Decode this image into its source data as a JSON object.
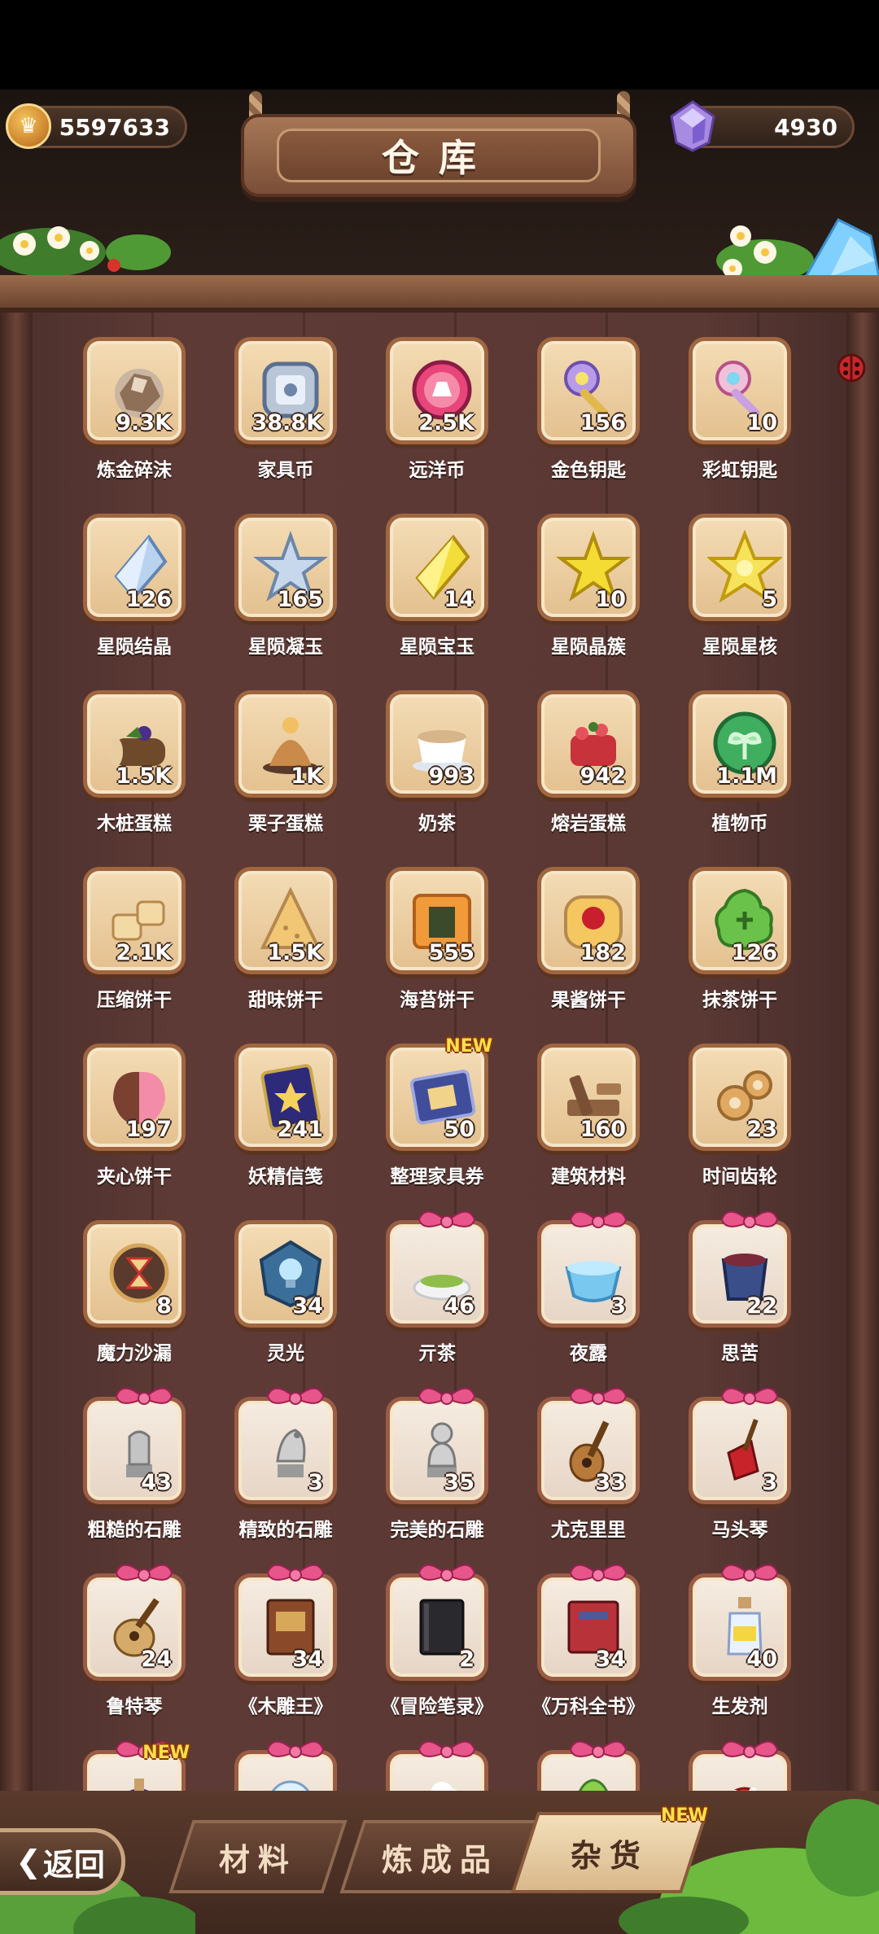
{
  "header": {
    "title": "仓库",
    "coins": "5597633",
    "gems": "4930"
  },
  "items": [
    {
      "name": "炼金碎沫",
      "count": "9.3K",
      "icon": "rock-rubble-icon",
      "type": "plain"
    },
    {
      "name": "家具币",
      "count": "38.8K",
      "icon": "furniture-coin-icon",
      "type": "plain"
    },
    {
      "name": "远洋币",
      "count": "2.5K",
      "icon": "ocean-coin-icon",
      "type": "plain"
    },
    {
      "name": "金色钥匙",
      "count": "156",
      "icon": "gold-key-icon",
      "type": "plain"
    },
    {
      "name": "彩虹钥匙",
      "count": "10",
      "icon": "rainbow-key-icon",
      "type": "plain"
    },
    {
      "name": "星陨结晶",
      "count": "126",
      "icon": "crystal-shard-icon",
      "type": "plain"
    },
    {
      "name": "星陨凝玉",
      "count": "165",
      "icon": "star-jade-icon",
      "type": "plain"
    },
    {
      "name": "星陨宝玉",
      "count": "14",
      "icon": "yellow-gem-icon",
      "type": "plain"
    },
    {
      "name": "星陨晶簇",
      "count": "10",
      "icon": "yellow-star-icon",
      "type": "plain"
    },
    {
      "name": "星陨星核",
      "count": "5",
      "icon": "star-core-icon",
      "type": "plain"
    },
    {
      "name": "木桩蛋糕",
      "count": "1.5K",
      "icon": "log-cake-icon",
      "type": "plain"
    },
    {
      "name": "栗子蛋糕",
      "count": "1K",
      "icon": "chestnut-cake-icon",
      "type": "plain"
    },
    {
      "name": "奶茶",
      "count": "993",
      "icon": "milk-tea-icon",
      "type": "plain"
    },
    {
      "name": "熔岩蛋糕",
      "count": "942",
      "icon": "lava-cake-icon",
      "type": "plain"
    },
    {
      "name": "植物币",
      "count": "1.1M",
      "icon": "plant-coin-icon",
      "type": "plain"
    },
    {
      "name": "压缩饼干",
      "count": "2.1K",
      "icon": "compressed-biscuit-icon",
      "type": "plain"
    },
    {
      "name": "甜味饼干",
      "count": "1.5K",
      "icon": "sweet-biscuit-icon",
      "type": "plain"
    },
    {
      "name": "海苔饼干",
      "count": "555",
      "icon": "seaweed-biscuit-icon",
      "type": "plain"
    },
    {
      "name": "果酱饼干",
      "count": "182",
      "icon": "jam-biscuit-icon",
      "type": "plain"
    },
    {
      "name": "抹茶饼干",
      "count": "126",
      "icon": "matcha-biscuit-icon",
      "type": "plain"
    },
    {
      "name": "夹心饼干",
      "count": "197",
      "icon": "sandwich-biscuit-icon",
      "type": "plain"
    },
    {
      "name": "妖精信笺",
      "count": "241",
      "icon": "fairy-letter-icon",
      "type": "plain"
    },
    {
      "name": "整理家具券",
      "count": "50",
      "icon": "furniture-ticket-icon",
      "type": "plain",
      "badge": "NEW"
    },
    {
      "name": "建筑材料",
      "count": "160",
      "icon": "building-material-icon",
      "type": "plain"
    },
    {
      "name": "时间齿轮",
      "count": "23",
      "icon": "gear-icon",
      "type": "plain"
    },
    {
      "name": "魔力沙漏",
      "count": "8",
      "icon": "hourglass-icon",
      "type": "plain"
    },
    {
      "name": "灵光",
      "count": "34",
      "icon": "inspiration-icon",
      "type": "plain"
    },
    {
      "name": "亓茶",
      "count": "46",
      "icon": "green-tea-icon",
      "type": "gift"
    },
    {
      "name": "夜露",
      "count": "3",
      "icon": "dew-bowl-icon",
      "type": "gift"
    },
    {
      "name": "思苦",
      "count": "22",
      "icon": "bitter-cup-icon",
      "type": "gift"
    },
    {
      "name": "粗糙的石雕",
      "count": "43",
      "icon": "rough-sculpture-icon",
      "type": "gift"
    },
    {
      "name": "精致的石雕",
      "count": "3",
      "icon": "fine-sculpture-icon",
      "type": "gift"
    },
    {
      "name": "完美的石雕",
      "count": "35",
      "icon": "perfect-sculpture-icon",
      "type": "gift"
    },
    {
      "name": "尤克里里",
      "count": "33",
      "icon": "ukulele-icon",
      "type": "gift"
    },
    {
      "name": "马头琴",
      "count": "3",
      "icon": "morin-khuur-icon",
      "type": "gift"
    },
    {
      "name": "鲁特琴",
      "count": "24",
      "icon": "lute-icon",
      "type": "gift"
    },
    {
      "name": "《木雕王》",
      "count": "34",
      "icon": "brown-book-icon",
      "type": "gift"
    },
    {
      "name": "《冒险笔录》",
      "count": "2",
      "icon": "black-book-icon",
      "type": "gift"
    },
    {
      "name": "《万科全书》",
      "count": "34",
      "icon": "red-book-icon",
      "type": "gift"
    },
    {
      "name": "生发剂",
      "count": "40",
      "icon": "potion-bottle-icon",
      "type": "gift"
    },
    {
      "name": "",
      "count": "",
      "icon": "purple-potion-icon",
      "type": "gift",
      "badge": "NEW"
    },
    {
      "name": "",
      "count": "",
      "icon": "snow-globe-icon",
      "type": "gift"
    },
    {
      "name": "",
      "count": "",
      "icon": "cotton-icon",
      "type": "gift"
    },
    {
      "name": "",
      "count": "",
      "icon": "green-hat-icon",
      "type": "gift"
    },
    {
      "name": "",
      "count": "",
      "icon": "mushroom-icon",
      "type": "gift"
    }
  ],
  "tabs": [
    {
      "label": "材料"
    },
    {
      "label": "炼成品"
    },
    {
      "label": "杂货",
      "active": true,
      "badge": "NEW"
    }
  ],
  "back_label": "返回",
  "colors": {
    "frame_border": "#a0663f",
    "frame_fill": "#e9c999",
    "wall": "#5a3834",
    "badge_yellow": "#ffdf4d"
  }
}
